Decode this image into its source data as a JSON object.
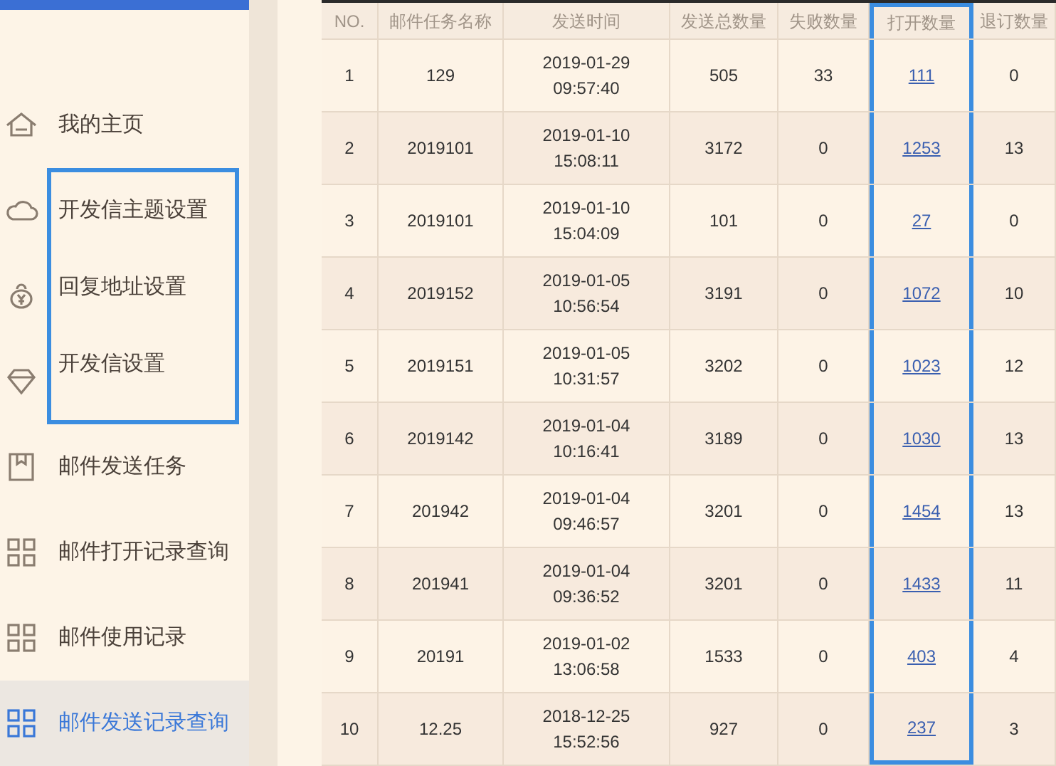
{
  "sidebar": {
    "items": [
      {
        "label": "我的主页",
        "kind": "home",
        "selected": false,
        "highlighted": false
      },
      {
        "label": "开发信主题设置",
        "kind": "cloud",
        "selected": false,
        "highlighted": true
      },
      {
        "label": "回复地址设置",
        "kind": "money-bag",
        "selected": false,
        "highlighted": true
      },
      {
        "label": "开发信设置",
        "kind": "diamond",
        "selected": false,
        "highlighted": true
      },
      {
        "label": "邮件发送任务",
        "kind": "bookmark",
        "selected": false,
        "highlighted": false
      },
      {
        "label": "邮件打开记录查询",
        "kind": "grid",
        "selected": false,
        "highlighted": false
      },
      {
        "label": "邮件使用记录",
        "kind": "grid",
        "selected": false,
        "highlighted": false
      },
      {
        "label": "邮件发送记录查询",
        "kind": "grid",
        "selected": true,
        "highlighted": false
      }
    ]
  },
  "table": {
    "columns": [
      {
        "label": "NO.",
        "kind": "text",
        "highlighted": false
      },
      {
        "label": "邮件任务名称",
        "kind": "text",
        "highlighted": false
      },
      {
        "label": "发送时间",
        "kind": "text",
        "highlighted": false
      },
      {
        "label": "发送总数量",
        "kind": "text",
        "highlighted": false
      },
      {
        "label": "失败数量",
        "kind": "text",
        "highlighted": false
      },
      {
        "label": "打开数量",
        "kind": "link",
        "highlighted": true
      },
      {
        "label": "退订数量",
        "kind": "text",
        "highlighted": false
      }
    ],
    "rows": [
      [
        "1",
        "129",
        [
          "2019-01-29",
          "09:57:40"
        ],
        "505",
        "33",
        "111",
        "0"
      ],
      [
        "2",
        "2019101",
        [
          "2019-01-10",
          "15:08:11"
        ],
        "3172",
        "0",
        "1253",
        "13"
      ],
      [
        "3",
        "2019101",
        [
          "2019-01-10",
          "15:04:09"
        ],
        "101",
        "0",
        "27",
        "0"
      ],
      [
        "4",
        "2019152",
        [
          "2019-01-05",
          "10:56:54"
        ],
        "3191",
        "0",
        "1072",
        "10"
      ],
      [
        "5",
        "2019151",
        [
          "2019-01-05",
          "10:31:57"
        ],
        "3202",
        "0",
        "1023",
        "12"
      ],
      [
        "6",
        "2019142",
        [
          "2019-01-04",
          "10:16:41"
        ],
        "3189",
        "0",
        "1030",
        "13"
      ],
      [
        "7",
        "201942",
        [
          "2019-01-04",
          "09:46:57"
        ],
        "3201",
        "0",
        "1454",
        "13"
      ],
      [
        "8",
        "201941",
        [
          "2019-01-04",
          "09:36:52"
        ],
        "3201",
        "0",
        "1433",
        "11"
      ],
      [
        "9",
        "20191",
        [
          "2019-01-02",
          "13:06:58"
        ],
        "1533",
        "0",
        "403",
        "4"
      ],
      [
        "10",
        "12.25",
        [
          "2018-12-25",
          "15:52:56"
        ],
        "927",
        "0",
        "237",
        "3"
      ]
    ]
  }
}
